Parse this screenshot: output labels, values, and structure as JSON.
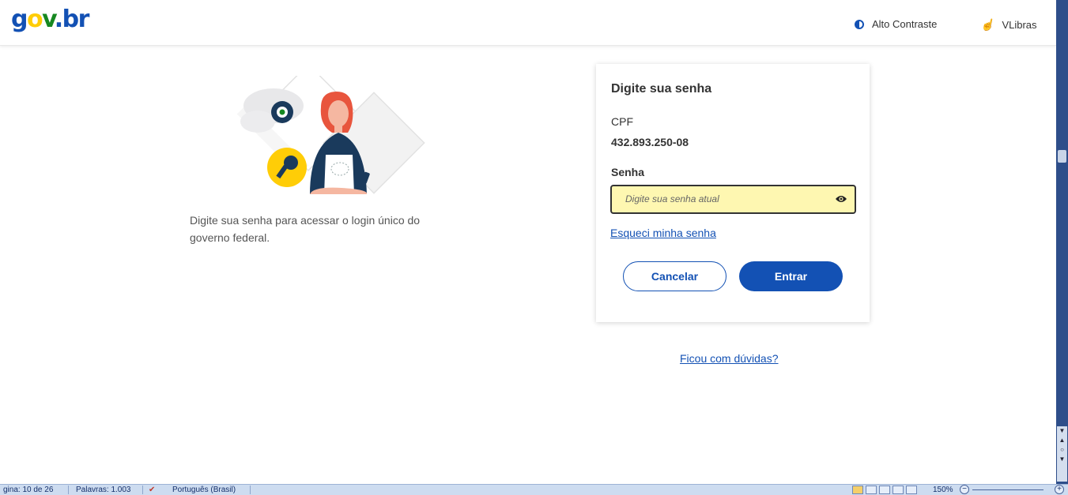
{
  "header": {
    "logo": {
      "part1": "g",
      "part2": "o",
      "part3": "v",
      "part4": ".br"
    },
    "contrast_label": "Alto Contraste",
    "libras_label": "VLibras"
  },
  "left": {
    "description": "Digite sua senha para acessar o login único do governo federal."
  },
  "card": {
    "title": "Digite sua senha",
    "cpf_label": "CPF",
    "cpf_value": "432.893.250-08",
    "password_label": "Senha",
    "password_placeholder": "Digite sua senha atual",
    "forgot_link": "Esqueci minha senha",
    "cancel_label": "Cancelar",
    "enter_label": "Entrar"
  },
  "help_link": "Ficou com dúvidas?",
  "statusbar": {
    "page": "gina: 10 de 26",
    "words": "Palavras: 1.003",
    "language": "Português (Brasil)",
    "zoom": "150%"
  },
  "colors": {
    "primary": "#1351b4",
    "logo_yellow": "#ffcd07",
    "logo_green": "#168821",
    "field_bg": "#fef7b1"
  }
}
